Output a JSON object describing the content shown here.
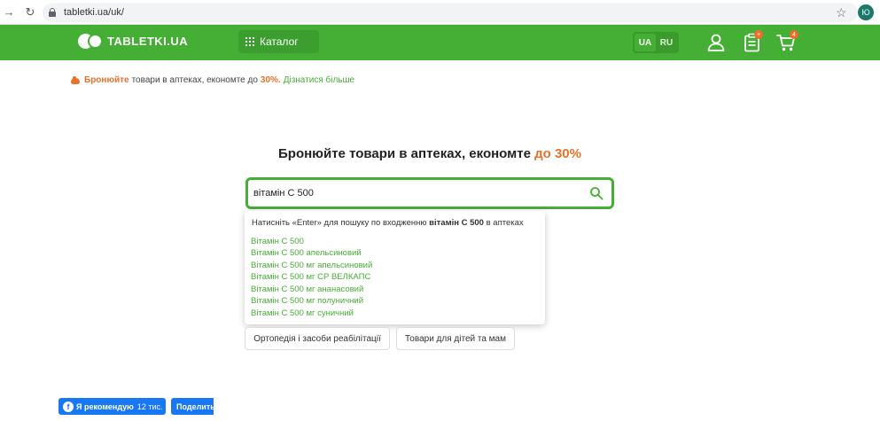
{
  "browser": {
    "url": "tabletki.ua/uk/",
    "profile_initial": "Ю"
  },
  "header": {
    "logo_text": "TABLETKI.UA",
    "catalog_label": "Каталог",
    "languages": [
      {
        "label": "UA",
        "active": true
      },
      {
        "label": "RU",
        "active": false
      }
    ],
    "list_badge": "+",
    "cart_badge": "4",
    "brand_color": "#45ae34",
    "accent_color": "#e8722a"
  },
  "promo": {
    "strong": "Бронюйте",
    "text": "товари в аптеках, економте до",
    "percent": "30%.",
    "link": "Дізнатися більше"
  },
  "hero": {
    "title_main": "Бронюйте товари в аптеках, економте",
    "title_accent": "до 30%"
  },
  "search": {
    "value": "вітамін С 500"
  },
  "dropdown": {
    "hint_before": "Натисніть «Enter» для пошуку по входженню",
    "hint_query": "вітамін С 500",
    "hint_after": "в аптеках",
    "suggestions": [
      "Вітамін С 500",
      "Вітамін С 500 апельсиновий",
      "Вітамін С 500 мг апельсиновий",
      "Вітамін С 500 мг СР ВЕЛКАПС",
      "Вітамін С 500 мг ананасовий",
      "Вітамін С 500 мг полуничний",
      "Вітамін С 500 мг суничний"
    ]
  },
  "categories": [
    "Ортопедія і засоби реабілітації",
    "Товари для дітей та мам"
  ],
  "social": {
    "like_label": "Я рекомендую",
    "like_count": "12 тис.",
    "share_label": "Поделиться"
  }
}
